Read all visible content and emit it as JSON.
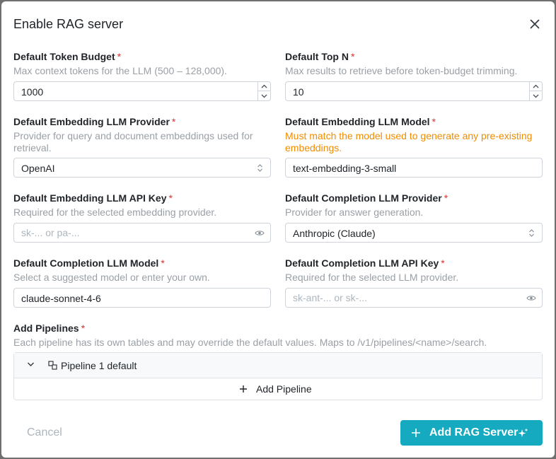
{
  "dialog": {
    "title": "Enable RAG server"
  },
  "fields": {
    "token_budget": {
      "label": "Default Token Budget",
      "required": "*",
      "description": "Max context tokens for the LLM (500 – 128,000).",
      "value": "1000"
    },
    "top_n": {
      "label": "Default Top N",
      "required": "*",
      "description": "Max results to retrieve before token-budget trimming.",
      "value": "10"
    },
    "embed_provider": {
      "label": "Default Embedding LLM Provider",
      "required": "*",
      "description": "Provider for query and document embeddings used for retrieval.",
      "value": "OpenAI"
    },
    "embed_model": {
      "label": "Default Embedding LLM Model",
      "required": "*",
      "description": "Must match the model used to generate any pre-existing embeddings.",
      "value": "text-embedding-3-small"
    },
    "embed_key": {
      "label": "Default Embedding LLM API Key",
      "required": "*",
      "description": "Required for the selected embedding provider.",
      "placeholder": "sk-... or pa-..."
    },
    "completion_provider": {
      "label": "Default Completion LLM Provider",
      "required": "*",
      "description": "Provider for answer generation.",
      "value": "Anthropic (Claude)"
    },
    "completion_model": {
      "label": "Default Completion LLM Model",
      "required": "*",
      "description": "Select a suggested model or enter your own.",
      "value": "claude-sonnet-4-6"
    },
    "completion_key": {
      "label": "Default Completion LLM API Key",
      "required": "*",
      "description": "Required for the selected LLM provider.",
      "placeholder": "sk-ant-... or sk-..."
    }
  },
  "pipelines": {
    "label": "Add Pipelines",
    "required": "*",
    "description": "Each pipeline has its own tables and may override the default values. Maps to /v1/pipelines/<name>/search.",
    "items": [
      {
        "name": "Pipeline 1 default"
      }
    ],
    "add_label": "Add Pipeline"
  },
  "footer": {
    "cancel_label": "Cancel",
    "submit_label": "Add RAG Server"
  },
  "colors": {
    "accent": "#15aabf",
    "required": "#e03131",
    "warning": "#f08c00"
  },
  "icons": {
    "close": "close-icon",
    "stepper_up": "chevron-up-icon",
    "stepper_down": "chevron-down-icon",
    "select": "selector-icon",
    "eye": "eye-icon",
    "expand": "chevron-down-icon",
    "pipeline": "pipeline-icon",
    "add": "plus-icon",
    "sparkle": "sparkles-icon"
  }
}
